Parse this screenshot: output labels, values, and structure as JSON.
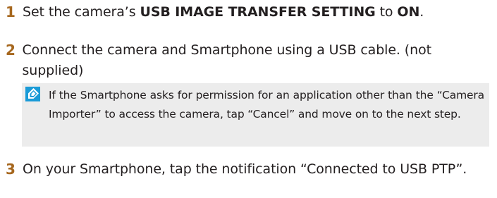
{
  "steps": [
    {
      "number": "1",
      "text_before": "Set the camera’s ",
      "setting_name": "USB IMAGE TRANSFER SETTING",
      "text_middle": " to ",
      "setting_value": "ON",
      "text_after": "."
    },
    {
      "number": "2",
      "text": "Connect the camera and Smartphone using a USB cable. (not supplied)"
    },
    {
      "number": "3",
      "text": "On your Smartphone, tap the notification “Connected to USB PTP”."
    }
  ],
  "note": {
    "icon": "note-icon",
    "text": "If the Smartphone asks for permission for an application other than the “Camera Importer” to access the camera, tap “Cancel” and move on to the next step."
  },
  "colors": {
    "step_number": "#a6671e",
    "note_background": "#ececec",
    "icon_blue": "#1a9bd7",
    "text": "#231f20"
  }
}
